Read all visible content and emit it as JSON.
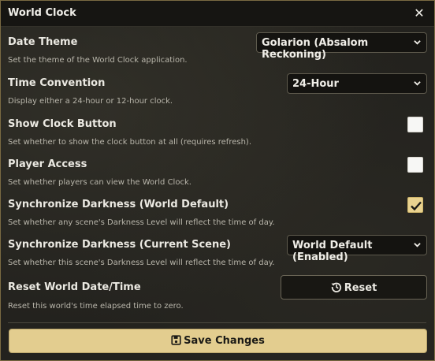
{
  "window": {
    "title": "World Clock",
    "accent_color": "#e3cd8f"
  },
  "settings": {
    "date_theme": {
      "label": "Date Theme",
      "hint": "Set the theme of the World Clock application.",
      "value": "Golarion (Absalom Reckoning)"
    },
    "time_convention": {
      "label": "Time Convention",
      "hint": "Display either a 24-hour or 12-hour clock.",
      "value": "24-Hour"
    },
    "show_clock_button": {
      "label": "Show Clock Button",
      "hint": "Set whether to show the clock button at all (requires refresh).",
      "checked": false
    },
    "player_access": {
      "label": "Player Access",
      "hint": "Set whether players can view the World Clock.",
      "checked": false
    },
    "sync_darkness_world": {
      "label": "Synchronize Darkness (World Default)",
      "hint": "Set whether any scene's Darkness Level will reflect the time of day.",
      "checked": true
    },
    "sync_darkness_scene": {
      "label": "Synchronize Darkness (Current Scene)",
      "hint": "Set whether this scene's Darkness Level will reflect the time of day.",
      "value": "World Default (Enabled)"
    },
    "reset_world_date": {
      "label": "Reset World Date/Time",
      "hint": "Reset this world's time elapsed time to zero.",
      "button_label": "Reset",
      "button_icon": "history-icon"
    }
  },
  "footer": {
    "save_label": "Save Changes",
    "save_icon": "save-icon"
  }
}
